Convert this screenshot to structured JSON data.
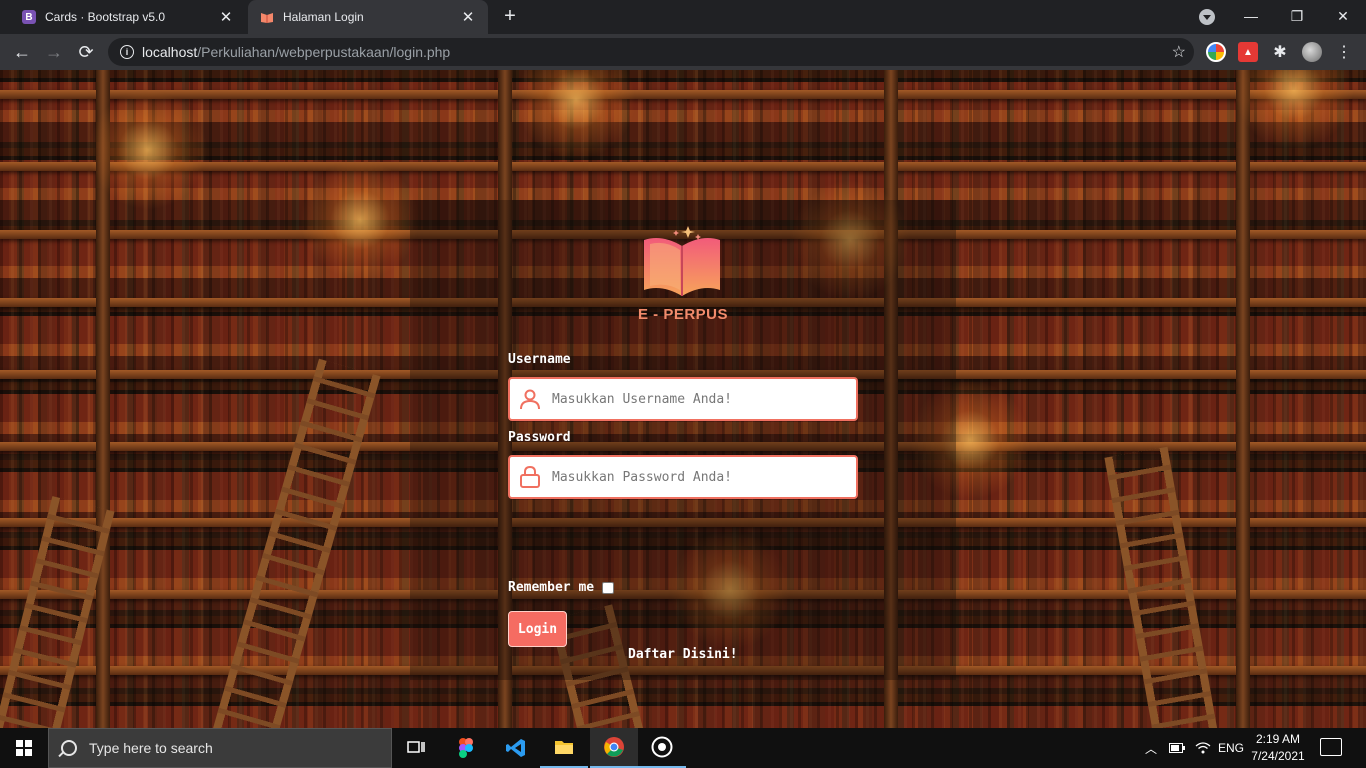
{
  "browser": {
    "tabs": [
      {
        "title": "Cards · Bootstrap v5.0",
        "favicon": "bootstrap-icon",
        "active": false
      },
      {
        "title": "Halaman Login",
        "favicon": "book-icon",
        "active": true
      }
    ],
    "url": {
      "host": "localhost",
      "path": "/Perkuliahan/webperpustakaan/login.php"
    }
  },
  "login": {
    "brand": "E - PERPUS",
    "username_label": "Username",
    "username_placeholder": "Masukkan Username Anda!",
    "password_label": "Password",
    "password_placeholder": "Masukkan Password Anda!",
    "remember_label": "Remember me",
    "login_button": "Login",
    "register_link": "Daftar Disini!",
    "accent_color": "#f56c62"
  },
  "taskbar": {
    "search_placeholder": "Type here to search",
    "language": "ENG",
    "time": "2:19 AM",
    "date": "7/24/2021",
    "apps": [
      "task-view-icon",
      "figma-icon",
      "vscode-icon",
      "file-explorer-icon",
      "chrome-icon",
      "obs-icon"
    ]
  }
}
